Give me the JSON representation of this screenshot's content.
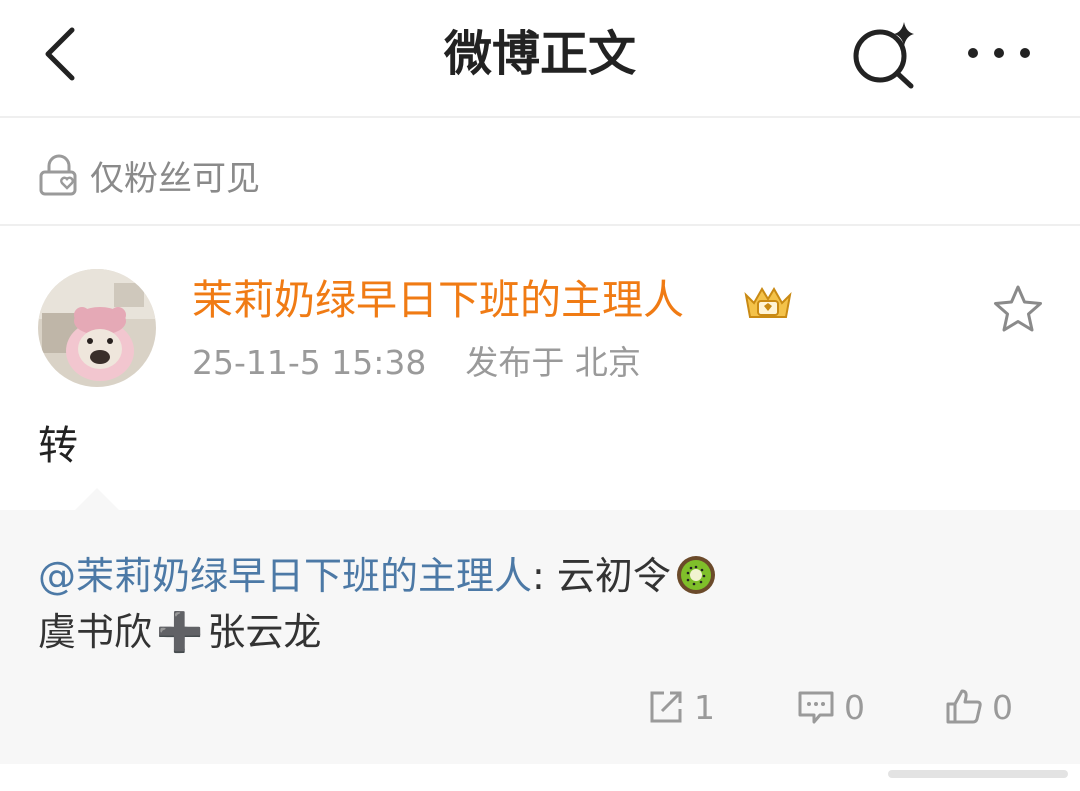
{
  "header": {
    "title": "微博正文",
    "back_icon": "chevron-left-icon",
    "search_icon": "search-sparkle-icon",
    "more_icon": "more-dots-icon"
  },
  "visibility": {
    "icon": "lock-heart-icon",
    "label": "仅粉丝可见"
  },
  "post": {
    "author": "茉莉奶绿早日下班的主理人",
    "author_color": "#f07b14",
    "badge_icon": "vip-crown-badge-icon",
    "datetime": "25-11-5 15:38",
    "location": "发布于 北京",
    "favorite_icon": "star-outline-icon",
    "text": "转"
  },
  "retweet": {
    "mention": "@茉莉奶绿早日下班的主理人",
    "separator": ": ",
    "content_line1": "云初令",
    "emoji_icon": "kiwi-emoji-icon",
    "name_a": "虞书欣",
    "plus": "➕",
    "name_b": "张云龙",
    "mention_color": "#4c79a6",
    "actions": {
      "repost_count": "1",
      "comment_count": "0",
      "like_count": "0"
    }
  }
}
